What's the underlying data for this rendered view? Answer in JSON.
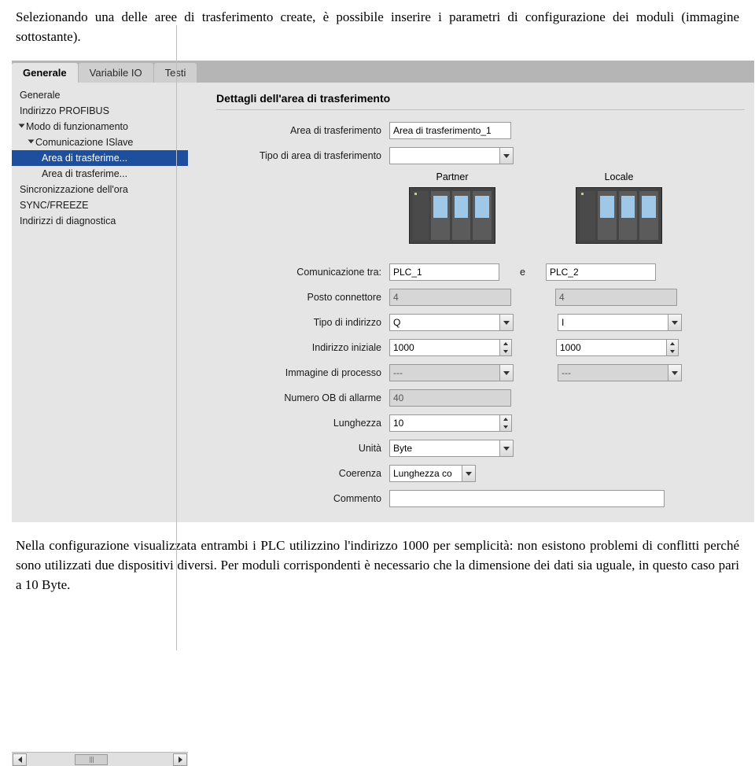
{
  "doc_intro": "Selezionando una delle aree di trasferimento create, è possibile inserire i parametri di configurazione dei moduli (immagine sottostante).",
  "tabs": {
    "generale": "Generale",
    "variabile": "Variabile IO",
    "testi": "Testi"
  },
  "sidebar": {
    "items": [
      "Generale",
      "Indirizzo PROFIBUS",
      "Modo di funzionamento",
      "Comunicazione ISlave",
      "Area di trasferime...",
      "Area di trasferime...",
      "Sincronizzazione dell'ora",
      "SYNC/FREEZE",
      "Indirizzi di diagnostica"
    ]
  },
  "section_title": "Dettagli dell'area di trasferimento",
  "labels": {
    "area": "Area di trasferimento",
    "tipo_area": "Tipo di area di trasferimento",
    "partner": "Partner",
    "locale": "Locale",
    "comunicazione_tra": "Comunicazione tra:",
    "e": "e",
    "posto_connettore": "Posto connettore",
    "tipo_indirizzo": "Tipo di indirizzo",
    "indirizzo_iniziale": "Indirizzo iniziale",
    "immagine_processo": "Immagine di processo",
    "numero_ob": "Numero OB di allarme",
    "lunghezza": "Lunghezza",
    "unita": "Unità",
    "coerenza": "Coerenza",
    "commento": "Commento"
  },
  "values": {
    "area": "Area di trasferimento_1",
    "tipo_area": "",
    "plc_a": "PLC_1",
    "plc_b": "PLC_2",
    "posto_a": "4",
    "posto_b": "4",
    "tipo_a": "Q",
    "tipo_b": "I",
    "ind_a": "1000",
    "ind_b": "1000",
    "img_a": "---",
    "img_b": "---",
    "ob": "40",
    "lunghezza": "10",
    "unita": "Byte",
    "coerenza": "Lunghezza co",
    "commento": ""
  },
  "doc_outro": "Nella configurazione visualizzata entrambi i PLC utilizzino l'indirizzo 1000 per semplicità: non esistono problemi di conflitti perché sono utilizzati due dispositivi diversi. Per moduli corrispondenti è necessario che la dimensione dei dati sia uguale, in questo caso pari a 10 Byte."
}
